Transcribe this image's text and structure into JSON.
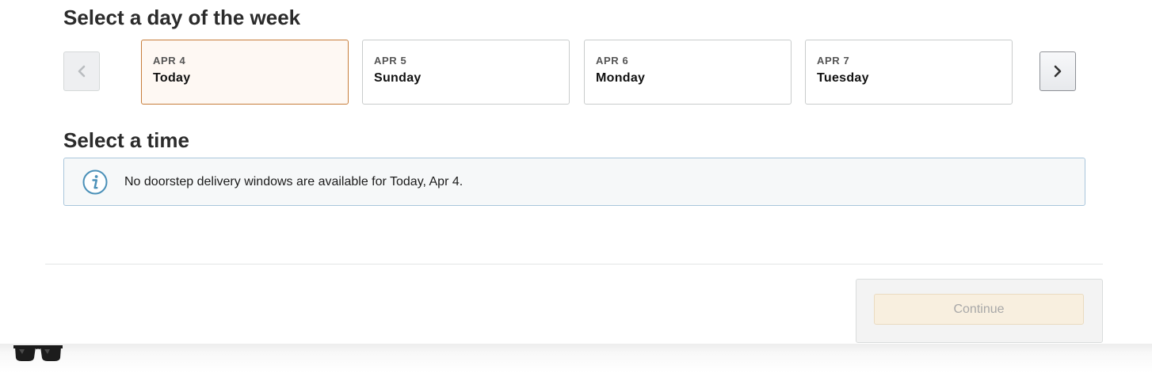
{
  "day_section": {
    "title": "Select a day of the week",
    "prev_icon": "chevron-left-icon",
    "next_icon": "chevron-right-icon",
    "days": [
      {
        "date": "APR 4",
        "name": "Today",
        "selected": true
      },
      {
        "date": "APR 5",
        "name": "Sunday",
        "selected": false
      },
      {
        "date": "APR 6",
        "name": "Monday",
        "selected": false
      },
      {
        "date": "APR 7",
        "name": "Tuesday",
        "selected": false
      }
    ]
  },
  "time_section": {
    "title": "Select a time",
    "info_icon": "info-icon",
    "info_message": "No doorstep delivery windows are available for Today, Apr 4."
  },
  "footer": {
    "continue_label": "Continue",
    "continue_enabled": false
  },
  "overlay": {
    "icon": "sunglasses-icon"
  },
  "colors": {
    "selected_border": "#c77d3a",
    "selected_background": "#fef8f3",
    "info_border": "#a9c6dc",
    "info_icon": "#4a90b8",
    "continue_disabled_bg": "#f8efdf"
  }
}
